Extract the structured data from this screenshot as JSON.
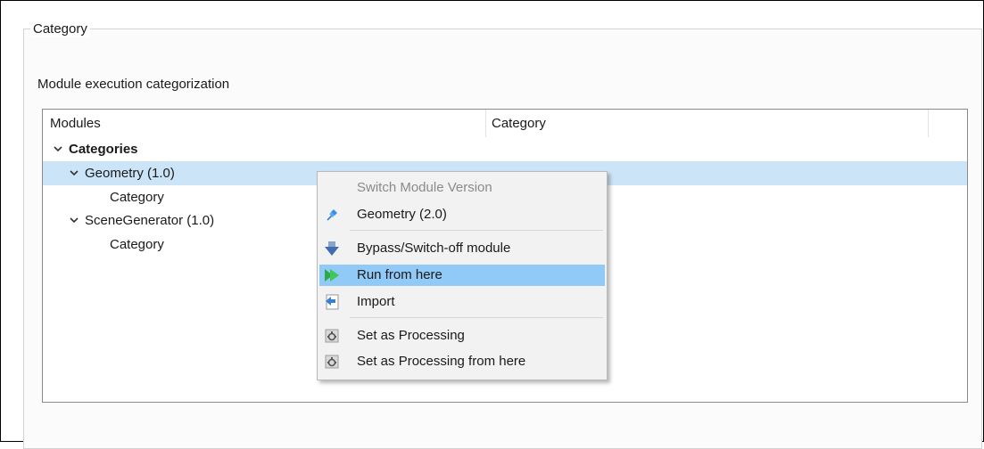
{
  "group": {
    "title": "Category"
  },
  "section_label": "Module execution categorization",
  "tree": {
    "columns": [
      "Modules",
      "Category"
    ],
    "rows": {
      "categories": "Categories",
      "geometry": "Geometry (1.0)",
      "geometry_category": "Category",
      "scene_generator": "SceneGenerator (1.0)",
      "scene_generator_category": "Category"
    }
  },
  "context_menu": {
    "header": "Switch Module Version",
    "version_item": "Geometry (2.0)",
    "bypass": "Bypass/Switch-off module",
    "run_from_here": "Run from here",
    "import": "Import",
    "set_processing": "Set as Processing",
    "set_processing_from_here": "Set as Processing from here"
  },
  "colors": {
    "selection": "#cce4f7",
    "menu_hover": "#91c9f7",
    "menu_background": "#f2f2f2"
  },
  "icons": {
    "expand": "chevron-down-icon",
    "version": "pin-icon",
    "bypass": "arrow-down-icon",
    "run": "double-play-icon",
    "import": "import-icon",
    "processing": "gear-icon"
  }
}
